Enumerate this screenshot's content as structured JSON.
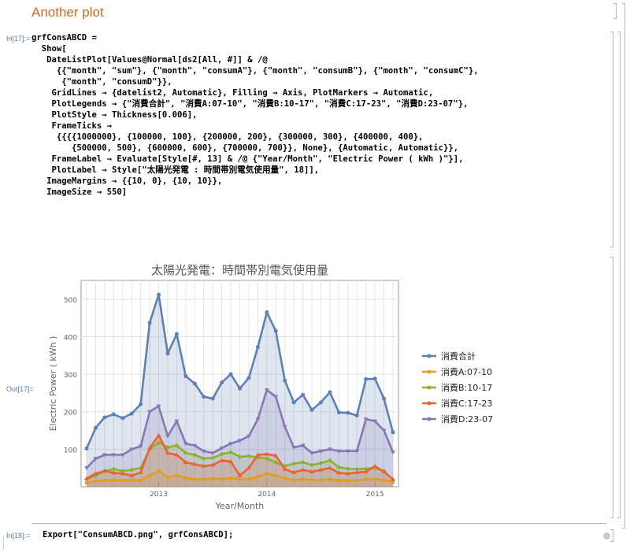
{
  "section": {
    "title": "Another plot"
  },
  "cells": {
    "in17_label": "In[17]:=",
    "out17_label": "Out[17]=",
    "in18_label": "In[18]:=",
    "code17": [
      "grfConsABCD =",
      "  Show[",
      "   DateListPlot[Values@Normal[ds2[All, #]] & /@",
      "     {{\"month\", \"sum\"}, {\"month\", \"consumA\"}, {\"month\", \"consumB\"}, {\"month\", \"consumC\"},",
      "      {\"month\", \"consumD\"}},",
      "    GridLines → {datelist2, Automatic}, Filling → Axis, PlotMarkers → Automatic,",
      "    PlotLegends → {\"消費合計\", \"消費A:07-10\", \"消費B:10-17\", \"消費C:17-23\", \"消費D:23-07\"},",
      "    PlotStyle → Thickness[0.006],",
      "    FrameTicks →",
      "     {{{{1000000}, {100000, 100}, {200000, 200}, {300000, 300}, {400000, 400},",
      "        {500000, 500}, {600000, 600}, {700000, 700}}, None}, {Automatic, Automatic}},",
      "    FrameLabel → Evaluate[Style[#, 13] & /@ {\"Year/Month\", \"Electric Power ( kWh )\"}],",
      "    PlotLabel → Style[\"太陽光発電 : 時間帯別電気使用量\", 18]],",
      "   ImageMargins → {{10, 0}, {10, 10}},",
      "   ImageSize → 550]"
    ],
    "code18": "Export[\"ConsumABCD.png\", grfConsABCD];"
  },
  "chart_data": {
    "type": "line",
    "title": "太陽光発電：時間帯別電気使用量",
    "xlabel": "Year/Month",
    "ylabel": "Electric Power ( kWh )",
    "ylim": [
      0,
      550
    ],
    "yticks": [
      100,
      200,
      300,
      400,
      500
    ],
    "xticks": [
      "2013",
      "2014",
      "2015"
    ],
    "x": [
      "2012-05",
      "2012-06",
      "2012-07",
      "2012-08",
      "2012-09",
      "2012-10",
      "2012-11",
      "2012-12",
      "2013-01",
      "2013-02",
      "2013-03",
      "2013-04",
      "2013-05",
      "2013-06",
      "2013-07",
      "2013-08",
      "2013-09",
      "2013-10",
      "2013-11",
      "2013-12",
      "2014-01",
      "2014-02",
      "2014-03",
      "2014-04",
      "2014-05",
      "2014-06",
      "2014-07",
      "2014-08",
      "2014-09",
      "2014-10",
      "2014-11",
      "2014-12",
      "2015-01",
      "2015-02",
      "2015-03"
    ],
    "series": [
      {
        "name": "消費合計",
        "color": "#5e81b5",
        "values": [
          102,
          157,
          185,
          193,
          183,
          195,
          220,
          437,
          512,
          355,
          407,
          295,
          275,
          240,
          235,
          278,
          300,
          262,
          290,
          372,
          465,
          415,
          283,
          225,
          245,
          205,
          225,
          252,
          198,
          197,
          190,
          287,
          288,
          235,
          145
        ]
      },
      {
        "name": "消費A:07-10",
        "color": "#e19c24",
        "values": [
          10,
          15,
          17,
          18,
          17,
          18,
          17,
          30,
          42,
          25,
          30,
          23,
          20,
          20,
          22,
          20,
          23,
          20,
          20,
          27,
          35,
          30,
          22,
          18,
          20,
          18,
          18,
          20,
          17,
          17,
          17,
          20,
          20,
          18,
          12
        ]
      },
      {
        "name": "消費B:10-17",
        "color": "#8fb032",
        "values": [
          20,
          30,
          42,
          47,
          42,
          45,
          50,
          100,
          118,
          105,
          110,
          90,
          85,
          75,
          77,
          87,
          92,
          80,
          82,
          78,
          75,
          65,
          55,
          62,
          65,
          58,
          63,
          70,
          52,
          48,
          47,
          48,
          50,
          42,
          18
        ]
      },
      {
        "name": "消費C:17-23",
        "color": "#eb6235",
        "values": [
          22,
          35,
          42,
          37,
          35,
          30,
          38,
          103,
          137,
          90,
          85,
          65,
          60,
          55,
          58,
          70,
          67,
          30,
          50,
          85,
          87,
          83,
          47,
          38,
          45,
          40,
          45,
          50,
          37,
          35,
          38,
          40,
          55,
          40,
          20
        ]
      },
      {
        "name": "消費D:23-07",
        "color": "#8778b3",
        "values": [
          50,
          75,
          85,
          85,
          85,
          100,
          108,
          200,
          215,
          135,
          175,
          115,
          110,
          95,
          90,
          103,
          115,
          123,
          135,
          180,
          258,
          240,
          160,
          105,
          110,
          90,
          95,
          100,
          95,
          95,
          95,
          180,
          175,
          150,
          92
        ]
      }
    ],
    "grid": true,
    "legend_position": "right"
  }
}
